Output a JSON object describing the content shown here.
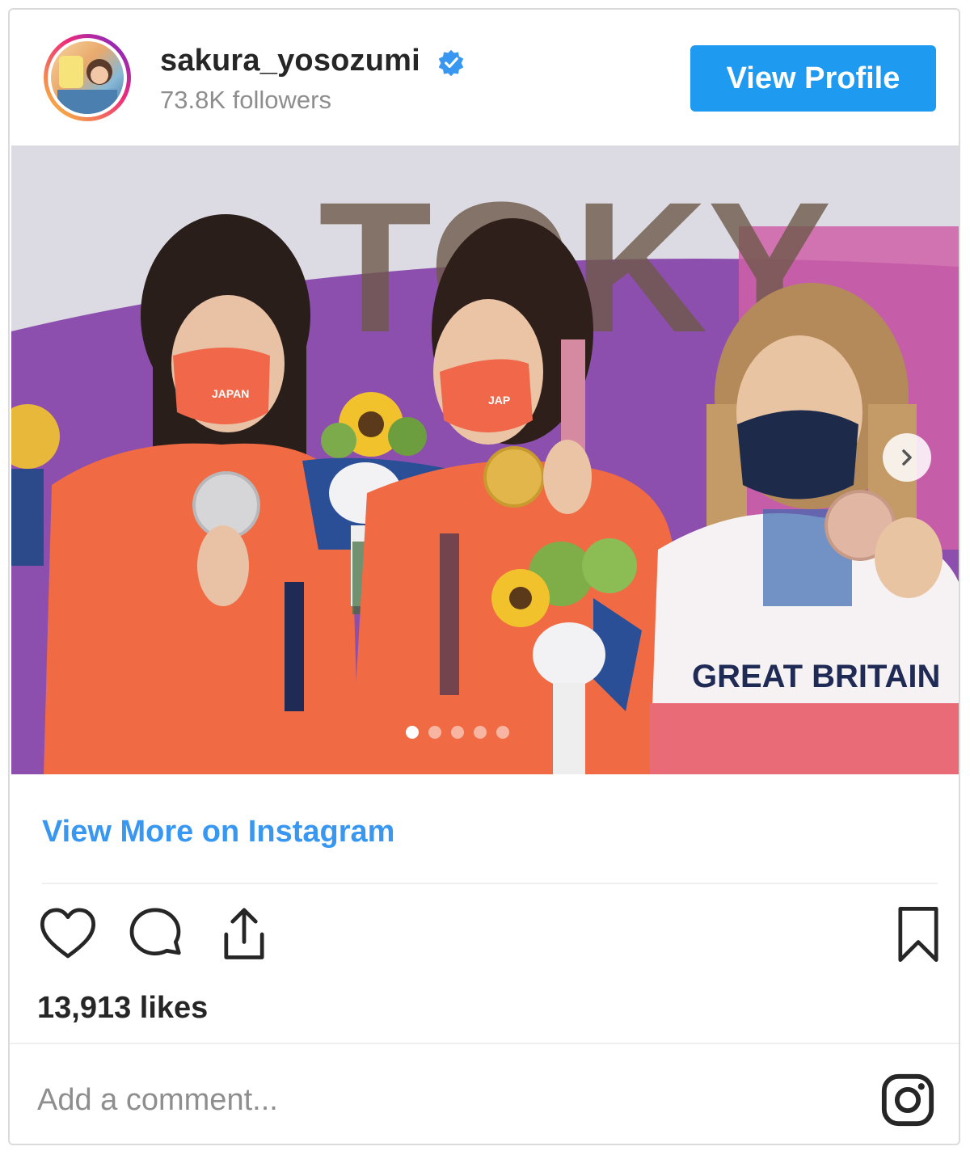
{
  "profile": {
    "username": "sakura_yosozumi",
    "followers": "73.8K followers",
    "view_profile_label": "View Profile",
    "verified_icon": "verified-badge-icon"
  },
  "post": {
    "image_text": {
      "banner": "TOKY",
      "mask_left": "JAPAN",
      "mask_center": "JAP",
      "jacket_right": "GREAT BRITAIN"
    },
    "carousel": {
      "total_slides": 5,
      "active_index": 0
    }
  },
  "links": {
    "view_more": "View More on Instagram"
  },
  "actions": {
    "like_icon": "heart-icon",
    "comment_icon": "comment-icon",
    "share_icon": "share-icon",
    "save_icon": "bookmark-icon"
  },
  "stats": {
    "likes": "13,913 likes"
  },
  "comment": {
    "placeholder": "Add a comment..."
  },
  "colors": {
    "primary_button": "#1e9bf0",
    "link": "#3897f0",
    "muted": "#8e8e8e"
  }
}
